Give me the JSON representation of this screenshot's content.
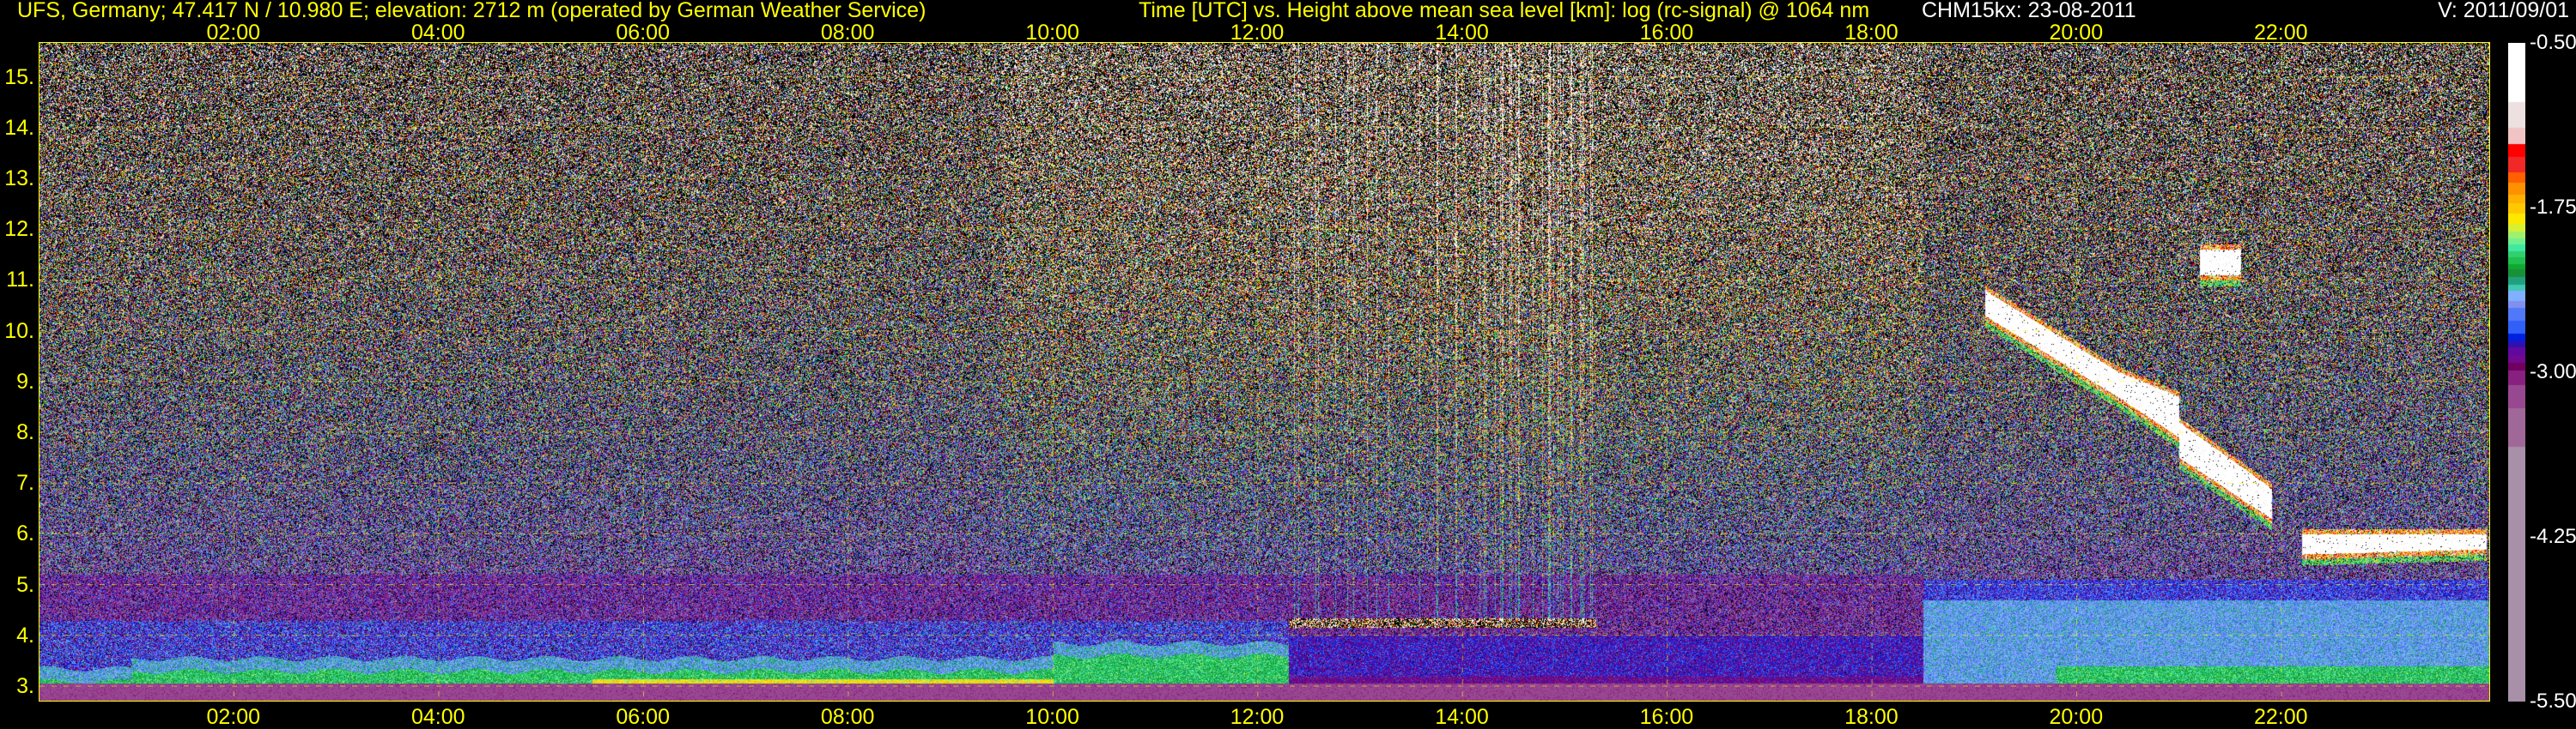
{
  "header": {
    "station": "UFS, Germany; 47.417 N / 10.980 E; elevation: 2712 m  (operated by German Weather Service)",
    "plot_title": "Time [UTC] vs. Height above mean sea level [km]: log (rc-signal) @ 1064 nm",
    "instrument_date": "CHM15kx: 23-08-2011",
    "version": "V: 2011/09/01"
  },
  "chart_data": {
    "type": "heatmap",
    "title": "Time [UTC] vs. Height above mean sea level [km]: log (rc-signal) @ 1064 nm",
    "xlabel": "Time [UTC]",
    "ylabel": "Height above mean sea level [km]",
    "xlim": [
      0.1,
      24.03
    ],
    "ylim": [
      2.712,
      15.67
    ],
    "x_ticks": [
      "02:00",
      "04:00",
      "06:00",
      "08:00",
      "10:00",
      "12:00",
      "14:00",
      "16:00",
      "18:00",
      "20:00",
      "22:00"
    ],
    "x_tick_values": [
      2,
      4,
      6,
      8,
      10,
      12,
      14,
      16,
      18,
      20,
      22
    ],
    "y_ticks": [
      "3.",
      "4.",
      "5.",
      "6.",
      "7.",
      "8.",
      "9.",
      "10.",
      "11.",
      "12.",
      "13.",
      "14.",
      "15."
    ],
    "y_tick_values": [
      3,
      4,
      5,
      6,
      7,
      8,
      9,
      10,
      11,
      12,
      13,
      14,
      15
    ],
    "grid": true,
    "colorbar": {
      "range": [
        -5.5,
        -0.5
      ],
      "tick_labels": [
        "-0.50",
        "-1.75",
        "-3.00",
        "-4.25",
        "-5.50"
      ],
      "tick_values": [
        -0.5,
        -1.75,
        -3.0,
        -4.25,
        -5.5
      ],
      "stops": [
        [
          -0.95,
          "#ffffff"
        ],
        [
          -1.14,
          "#ece0e0"
        ],
        [
          -1.27,
          "#f0c4c4"
        ],
        [
          -1.37,
          "#ff0000"
        ],
        [
          -1.48,
          "#f02828"
        ],
        [
          -1.56,
          "#ff6000"
        ],
        [
          -1.65,
          "#ff9000"
        ],
        [
          -1.72,
          "#ffb000"
        ],
        [
          -1.8,
          "#ffc800"
        ],
        [
          -1.87,
          "#ffe800"
        ],
        [
          -1.93,
          "#d8f030"
        ],
        [
          -1.98,
          "#a0f070"
        ],
        [
          -2.03,
          "#70f090"
        ],
        [
          -2.08,
          "#40e8a0"
        ],
        [
          -2.13,
          "#30d070"
        ],
        [
          -2.18,
          "#20c050"
        ],
        [
          -2.22,
          "#10a830"
        ],
        [
          -2.28,
          "#189038"
        ],
        [
          -2.33,
          "#20a080"
        ],
        [
          -2.38,
          "#40c8b0"
        ],
        [
          -2.46,
          "#80b0ff"
        ],
        [
          -2.51,
          "#8090f0"
        ],
        [
          -2.61,
          "#5078f8"
        ],
        [
          -2.71,
          "#3060f8"
        ],
        [
          -2.77,
          "#0020e0"
        ],
        [
          -2.81,
          "#3010b0"
        ],
        [
          -2.87,
          "#6008a0"
        ],
        [
          -2.93,
          "#700890"
        ],
        [
          -2.99,
          "#700060"
        ],
        [
          -3.1,
          "#882080"
        ],
        [
          -3.27,
          "#984890"
        ],
        [
          -3.57,
          "#a06898"
        ],
        [
          -5.5,
          "#a890a8"
        ]
      ]
    },
    "cloud_segments": [
      {
        "t": [
          19.1,
          20.4
        ],
        "base": [
          10.2,
          8.6
        ],
        "top": [
          10.9,
          9.3
        ]
      },
      {
        "t": [
          20.4,
          21.0
        ],
        "base": [
          8.6,
          7.8
        ],
        "top": [
          9.3,
          8.8
        ]
      },
      {
        "t": [
          21.0,
          21.9
        ],
        "base": [
          7.4,
          6.2
        ],
        "top": [
          8.3,
          7.0
        ]
      },
      {
        "t": [
          21.2,
          21.6
        ],
        "base": [
          11.0,
          11.0
        ],
        "top": [
          11.7,
          11.7
        ]
      },
      {
        "t": [
          22.2,
          24.0
        ],
        "base": [
          5.5,
          5.6
        ],
        "top": [
          6.1,
          6.1
        ]
      }
    ]
  }
}
